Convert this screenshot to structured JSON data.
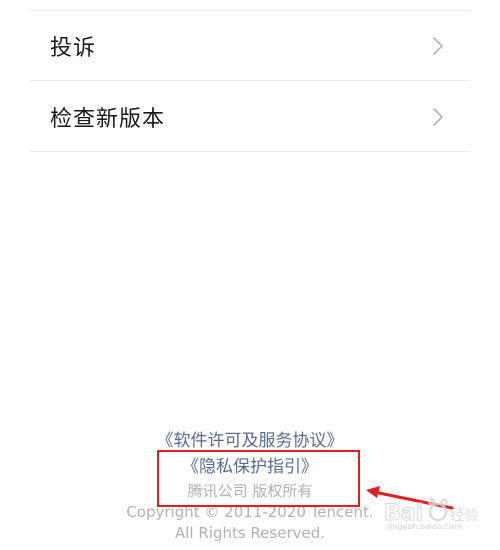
{
  "menu": {
    "items": [
      {
        "label": "投诉",
        "icon": "chevron-right-icon"
      },
      {
        "label": "检查新版本",
        "icon": "chevron-right-icon"
      }
    ]
  },
  "footer": {
    "license_link": "《软件许可及服务协议》",
    "privacy_link": "《隐私保护指引》",
    "company_line": "腾讯公司 版权所有",
    "copyright_line1": "Copyright © 2011-2020 Tencent.",
    "copyright_line2": "All Rights Reserved."
  },
  "annotation": {
    "box_color": "#e02020",
    "arrow_color": "#e02020"
  },
  "watermark": {
    "domain": "jingyan.baidu.com"
  },
  "colors": {
    "link": "#576b95",
    "muted": "#b2b2b2",
    "text": "#1a1a1a",
    "divider": "#ececec"
  }
}
